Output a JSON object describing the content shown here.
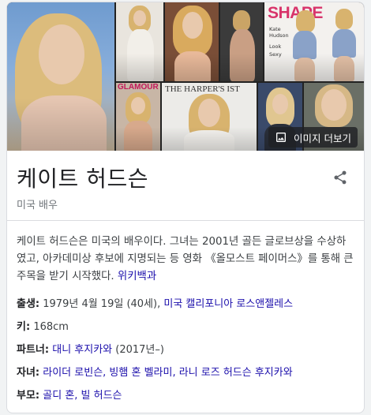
{
  "gallery": {
    "more_images_label": "이미지 더보기",
    "magazine1": {
      "masthead": "SHAPE",
      "cover_lines": [
        "Kate",
        "Hudson",
        "Look",
        "Sexy"
      ]
    },
    "magazine2": {
      "masthead": "GLAMOUR"
    },
    "magazine3": {
      "masthead": "THE HARPER'S IST"
    }
  },
  "entity": {
    "name": "케이트 허드슨",
    "subtitle": "미국 배우"
  },
  "description": {
    "text": "케이트 허드슨은 미국의 배우이다. 그녀는 2001년 골든 글로브상을 수상하였고, 아카데미상 후보에 지명되는 등 영화 《올모스트 페이머스》를 통해 큰 주목을 받기 시작했다.",
    "source_link": "위키백과"
  },
  "facts": [
    {
      "label": "출생",
      "plain": "1979년 4월 19일 (40세),",
      "link": "미국 캘리포니아 로스앤젤레스",
      "tail": ""
    },
    {
      "label": "키",
      "plain": "168cm",
      "link": "",
      "tail": ""
    },
    {
      "label": "파트너",
      "plain": "",
      "link": "대니 후지카와",
      "tail": "(2017년–)"
    },
    {
      "label": "자녀",
      "plain": "",
      "link": "라이더 로빈슨, 빙햄 혼 벨라미, 라니 로즈 허드슨 후지카와",
      "tail": ""
    },
    {
      "label": "부모",
      "plain": "",
      "link": "골디 혼, 빌 허드슨",
      "tail": ""
    }
  ],
  "colors": {
    "link": "#1a0dab",
    "text": "#3c4043",
    "muted": "#70757a"
  }
}
